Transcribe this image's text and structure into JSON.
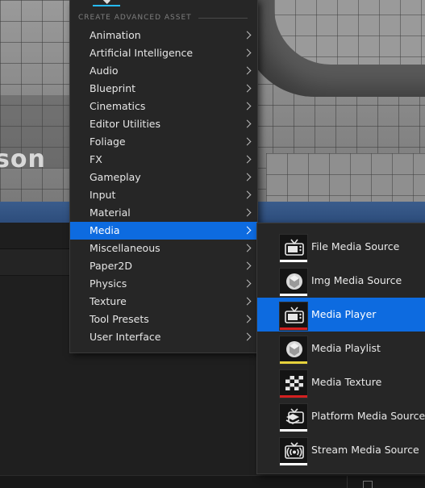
{
  "menu": {
    "section_header": "CREATE ADVANCED ASSET",
    "items": [
      {
        "label": "Animation"
      },
      {
        "label": "Artificial Intelligence"
      },
      {
        "label": "Audio"
      },
      {
        "label": "Blueprint"
      },
      {
        "label": "Cinematics"
      },
      {
        "label": "Editor Utilities"
      },
      {
        "label": "Foliage"
      },
      {
        "label": "FX"
      },
      {
        "label": "Gameplay"
      },
      {
        "label": "Input"
      },
      {
        "label": "Material"
      },
      {
        "label": "Media",
        "selected": true
      },
      {
        "label": "Miscellaneous"
      },
      {
        "label": "Paper2D"
      },
      {
        "label": "Physics"
      },
      {
        "label": "Texture"
      },
      {
        "label": "Tool Presets"
      },
      {
        "label": "User Interface"
      }
    ]
  },
  "submenu": {
    "items": [
      {
        "label": "File Media Source",
        "icon": "tv-icon",
        "color_bar": "#ffffff"
      },
      {
        "label": "Img Media Source",
        "icon": "sphere-icon",
        "color_bar": "#ffffff"
      },
      {
        "label": "Media Player",
        "icon": "tv-icon",
        "color_bar": "#d42020",
        "selected": true
      },
      {
        "label": "Media Playlist",
        "icon": "sphere-icon",
        "color_bar": "#e6d23c"
      },
      {
        "label": "Media Texture",
        "icon": "checker-icon",
        "color_bar": "#d42020"
      },
      {
        "label": "Platform Media Source",
        "icon": "layers-icon",
        "color_bar": "#ffffff"
      },
      {
        "label": "Stream Media Source",
        "icon": "broadcast-icon",
        "color_bar": "#ffffff"
      }
    ]
  },
  "viewport": {
    "watermark": "son"
  },
  "colors": {
    "menu_bg": "#262626",
    "selection": "#0d6be0",
    "accent": "#26bbff"
  }
}
